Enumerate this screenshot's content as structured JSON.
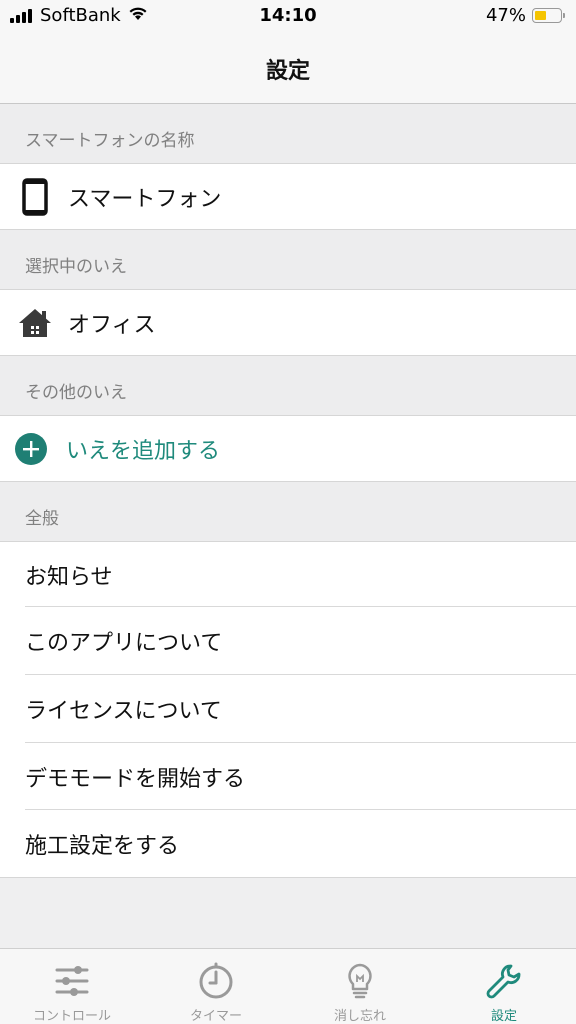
{
  "status_bar": {
    "carrier": "SoftBank",
    "time": "14:10",
    "battery": "47%",
    "battery_level": 0.47,
    "wifi_icon": "wifi-icon",
    "signal_icon": "cellular-signal-icon"
  },
  "nav": {
    "title": "設定"
  },
  "sections": {
    "phone_name": {
      "header": "スマートフォンの名称",
      "value": "スマートフォン",
      "icon": "smartphone-icon"
    },
    "selected_home": {
      "header": "選択中のいえ",
      "value": "オフィス",
      "icon": "house-icon"
    },
    "other_homes": {
      "header": "その他のいえ",
      "add_label": "いえを追加する",
      "icon": "plus-circle-icon"
    },
    "general": {
      "header": "全般",
      "items": [
        "お知らせ",
        "このアプリについて",
        "ライセンスについて",
        "デモモードを開始する",
        "施工設定をする"
      ]
    }
  },
  "tab_bar": {
    "tabs": [
      {
        "label": "コントロール",
        "icon": "sliders-icon"
      },
      {
        "label": "タイマー",
        "icon": "timer-icon"
      },
      {
        "label": "消し忘れ",
        "icon": "lightbulb-icon"
      },
      {
        "label": "設定",
        "icon": "wrench-icon"
      }
    ],
    "active_index": 3
  },
  "colors": {
    "accent": "#1f8a7c",
    "section_bg": "#ededee",
    "battery": "#f5c400"
  }
}
